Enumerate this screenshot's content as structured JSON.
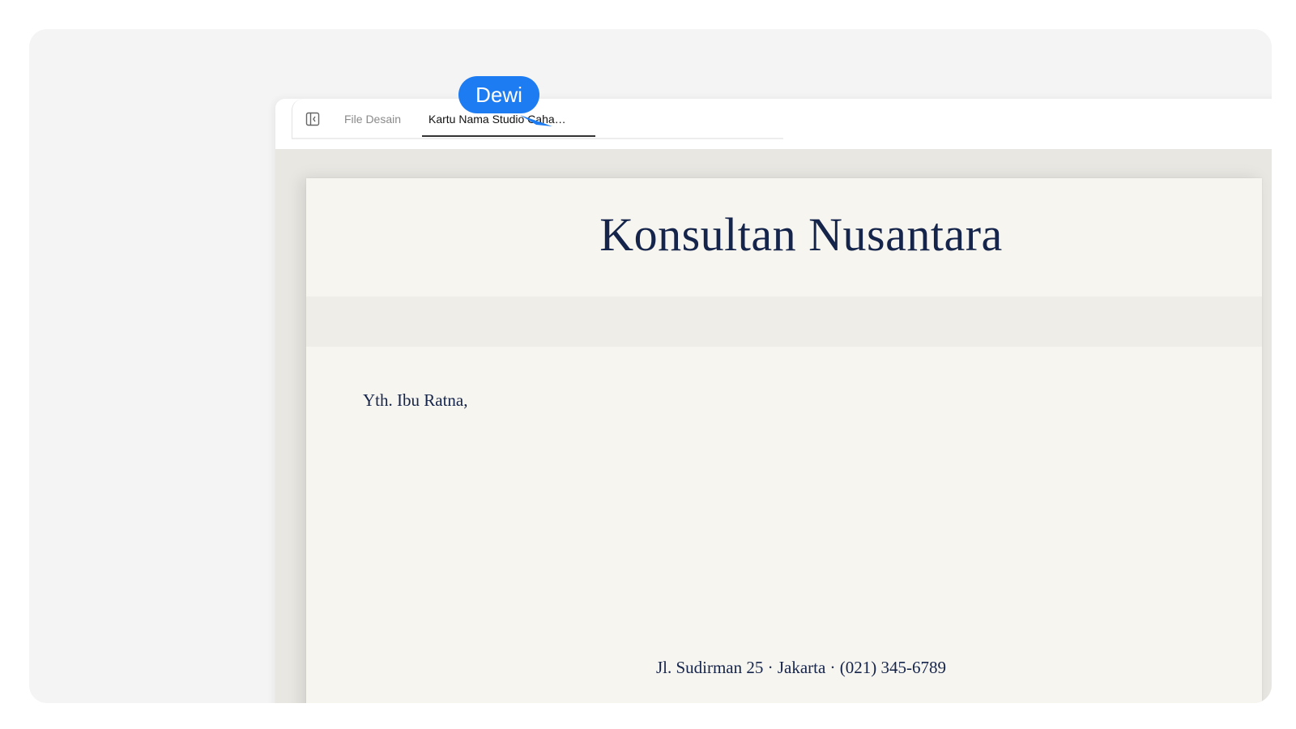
{
  "tabs": {
    "files_label": "File Desain",
    "active_label": "Kartu Nama Studio Caha…"
  },
  "collaborator": {
    "name": "Dewi",
    "color": "#1e7cf2"
  },
  "document": {
    "company_name": "Konsultan Nusantara",
    "salutation": "Yth. Ibu Ratna,",
    "footer_address": "Jl. Sudirman 25 · Jakarta · (021) 345-6789"
  },
  "icons": {
    "sidebar_toggle": "sidebar-toggle-icon",
    "cursor": "cursor-arrow-icon"
  },
  "colors": {
    "ink": "#15244a",
    "paper": "#f7f5f0"
  }
}
